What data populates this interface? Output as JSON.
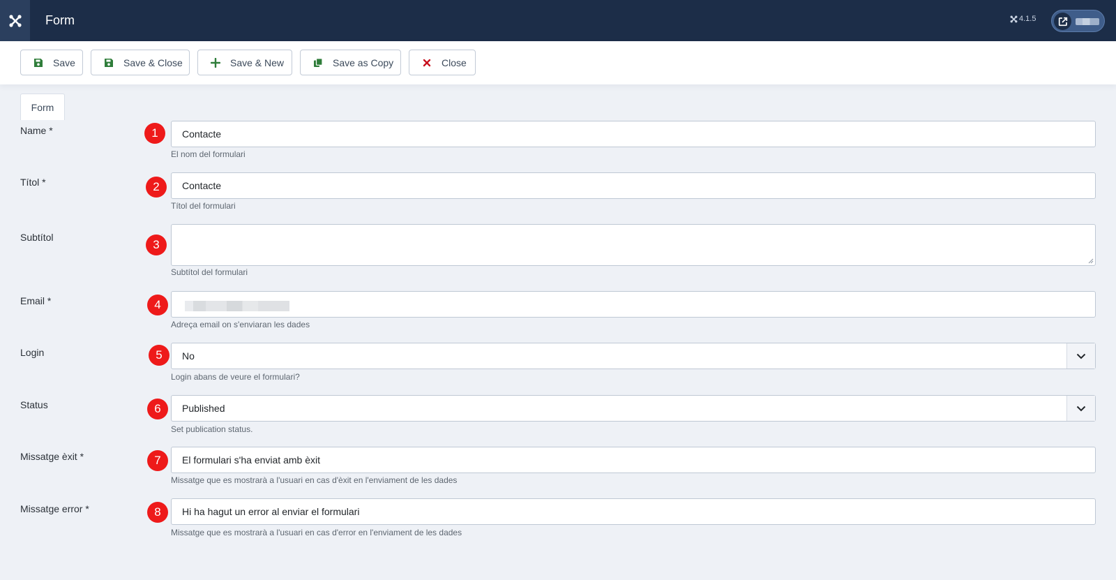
{
  "header": {
    "title": "Form",
    "version": "4.1.5",
    "logo_icon": "joomla-logo-icon",
    "external_icon": "external-link-icon"
  },
  "toolbar": {
    "buttons": [
      {
        "label": "Save",
        "icon": "save-icon"
      },
      {
        "label": "Save & Close",
        "icon": "save-icon"
      },
      {
        "label": "Save & New",
        "icon": "plus-icon"
      },
      {
        "label": "Save as Copy",
        "icon": "copy-icon"
      },
      {
        "label": "Close",
        "icon": "close-icon"
      }
    ]
  },
  "tabs": [
    {
      "label": "Form"
    }
  ],
  "form": {
    "fields": [
      {
        "label": "Name *",
        "value": "Contacte",
        "help": "El nom del formulari",
        "marker": "1"
      },
      {
        "label": "Títol *",
        "value": "Contacte",
        "help": "Títol del formulari",
        "marker": "2"
      },
      {
        "label": "Subtítol",
        "value": "",
        "help": "Subtítol del formulari",
        "marker": "3"
      },
      {
        "label": "Email *",
        "value": "",
        "help": "Adreça email on s'enviaran les dades",
        "marker": "4"
      },
      {
        "label": "Login",
        "value": "No",
        "help": "Login abans de veure el formulari?",
        "marker": "5"
      },
      {
        "label": "Status",
        "value": "Published",
        "help": "Set publication status.",
        "marker": "6"
      },
      {
        "label": "Missatge èxit *",
        "value": "El formulari s'ha enviat amb èxit",
        "help": "Missatge que es mostrarà a l'usuari en cas d'èxit en l'enviament de les dades",
        "marker": "7"
      },
      {
        "label": "Missatge error *",
        "value": "Hi ha hagut un error al enviar el formulari",
        "help": "Missatge que es mostrarà a l'usuari en cas d'error en l'enviament de les dades",
        "marker": "8"
      }
    ]
  },
  "colors": {
    "header_bg": "#1c2d48",
    "badge_red": "#ee1a1a",
    "save_green": "#2f7d3a",
    "close_red": "#c8101e"
  }
}
